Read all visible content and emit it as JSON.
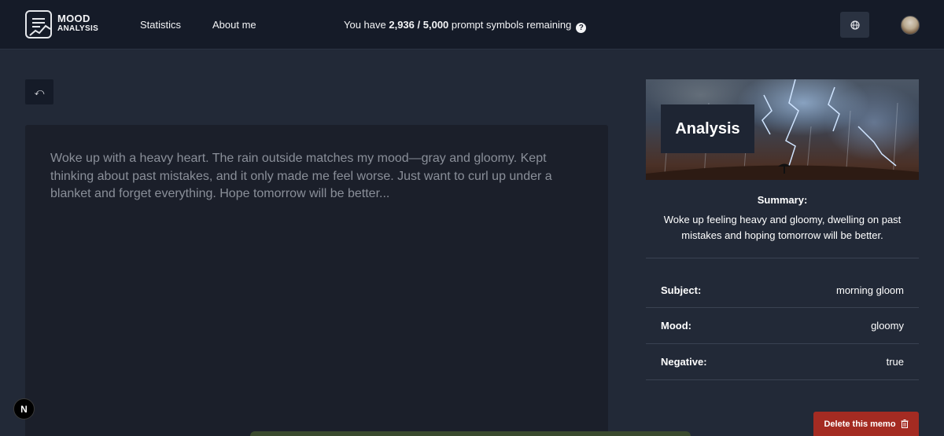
{
  "header": {
    "logo_line1": "MOOD",
    "logo_line2": "ANALYSIS",
    "nav": [
      {
        "label": "Statistics"
      },
      {
        "label": "About me"
      }
    ],
    "quota": {
      "prefix": "You have ",
      "used": "2,936",
      "separator": " / ",
      "total": "5,000",
      "suffix": " prompt symbols remaining",
      "help_glyph": "?"
    },
    "language_icon": "globe-icon",
    "avatar_icon": "user-avatar"
  },
  "back_button": {
    "glyph": "⤺",
    "icon": "back-arrow-icon"
  },
  "editor": {
    "text": "Woke up with a heavy heart. The rain outside matches my mood—gray and gloomy. Kept thinking about past mistakes, and it only made me feel worse. Just want to curl up under a blanket and forget everything. Hope tomorrow will be better..."
  },
  "analysis": {
    "title": "Analysis",
    "summary_label": "Summary:",
    "summary_text": "Woke up feeling heavy and gloomy, dwelling on past mistakes and hoping tomorrow will be better.",
    "rows": [
      {
        "key": "Subject:",
        "value": "morning gloom"
      },
      {
        "key": "Mood:",
        "value": "gloomy"
      },
      {
        "key": "Negative:",
        "value": "true"
      }
    ],
    "delete_label": "Delete this memo",
    "delete_icon": "trash-icon"
  },
  "next_badge": "N",
  "colors": {
    "page_bg": "#222937",
    "header_bg": "#151b28",
    "editor_bg": "#1b1f2a",
    "delete_bg": "#a42b22"
  }
}
